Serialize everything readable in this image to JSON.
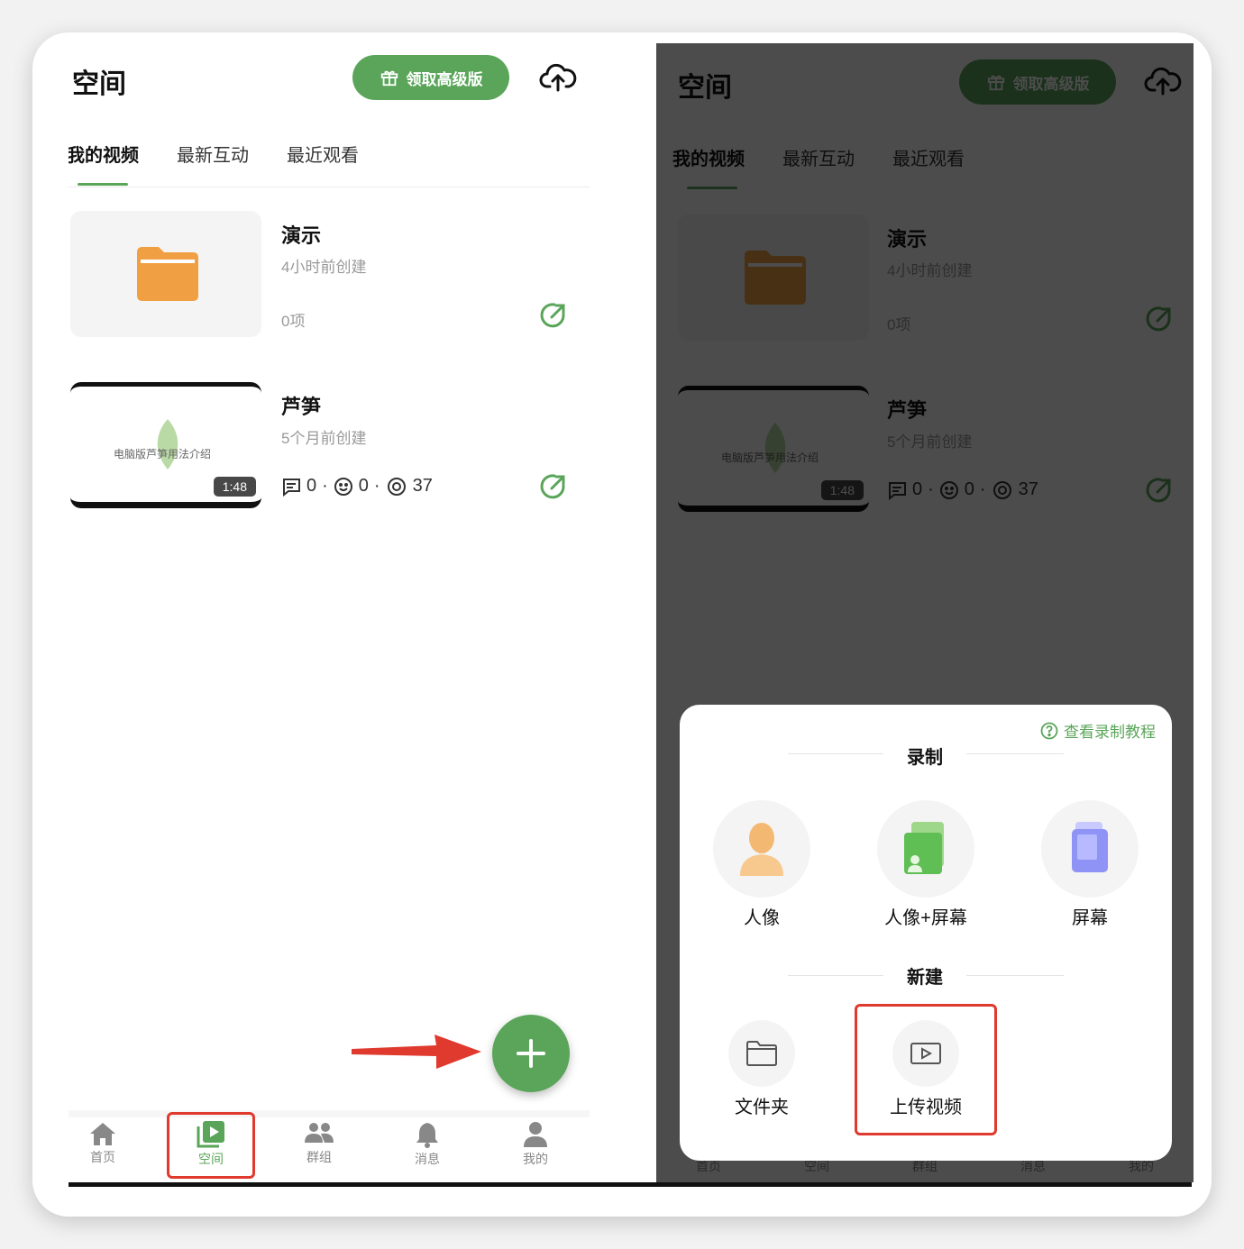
{
  "app": {
    "title": "空间",
    "premium_button": "领取高级版",
    "tabs": [
      "我的视频",
      "最新互动",
      "最近观看"
    ],
    "left_tab_first_visible": "我的视频"
  },
  "items": [
    {
      "title": "演示",
      "meta": "4小时前创建",
      "count": "0项"
    },
    {
      "title": "芦笋",
      "meta": "5个月前创建",
      "thumb_text": "电脑版芦笋用法介绍",
      "duration": "1:48",
      "comments": "0",
      "reactions": "0",
      "views": "37",
      "sep": "·"
    }
  ],
  "nav": [
    "首页",
    "空间",
    "群组",
    "消息",
    "我的"
  ],
  "sheet": {
    "tutorial_link": "查看录制教程",
    "record_title": "录制",
    "record_options": [
      "人像",
      "人像+屏幕",
      "屏幕"
    ],
    "new_title": "新建",
    "new_options": [
      "文件夹",
      "上传视频"
    ]
  },
  "colors": {
    "accent": "#5aa55a",
    "highlight": "#e0392e",
    "folder": "#f0a043"
  }
}
